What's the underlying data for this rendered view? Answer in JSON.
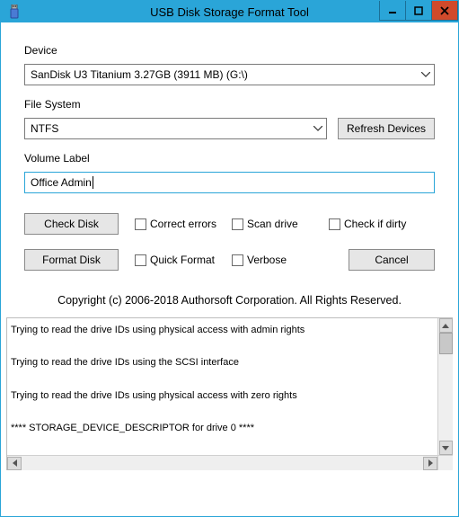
{
  "window": {
    "title": "USB Disk Storage Format Tool"
  },
  "labels": {
    "device": "Device",
    "file_system": "File System",
    "volume_label": "Volume Label"
  },
  "device": {
    "selected": "SanDisk U3 Titanium 3.27GB (3911 MB)  (G:\\)"
  },
  "file_system": {
    "selected": "NTFS"
  },
  "volume_label": {
    "value": "Office Admin"
  },
  "buttons": {
    "refresh": "Refresh Devices",
    "check_disk": "Check Disk",
    "format_disk": "Format Disk",
    "cancel": "Cancel"
  },
  "checkboxes": {
    "correct_errors": "Correct errors",
    "scan_drive": "Scan drive",
    "check_if_dirty": "Check if dirty",
    "quick_format": "Quick Format",
    "verbose": "Verbose"
  },
  "copyright": "Copyright (c) 2006-2018 Authorsoft Corporation. All Rights Reserved.",
  "log": {
    "lines": [
      "Trying to read the drive IDs using physical access with admin rights",
      "Trying to read the drive IDs using the SCSI interface",
      "Trying to read the drive IDs using physical access with zero rights",
      "**** STORAGE_DEVICE_DESCRIPTOR for drive 0 ****"
    ]
  }
}
